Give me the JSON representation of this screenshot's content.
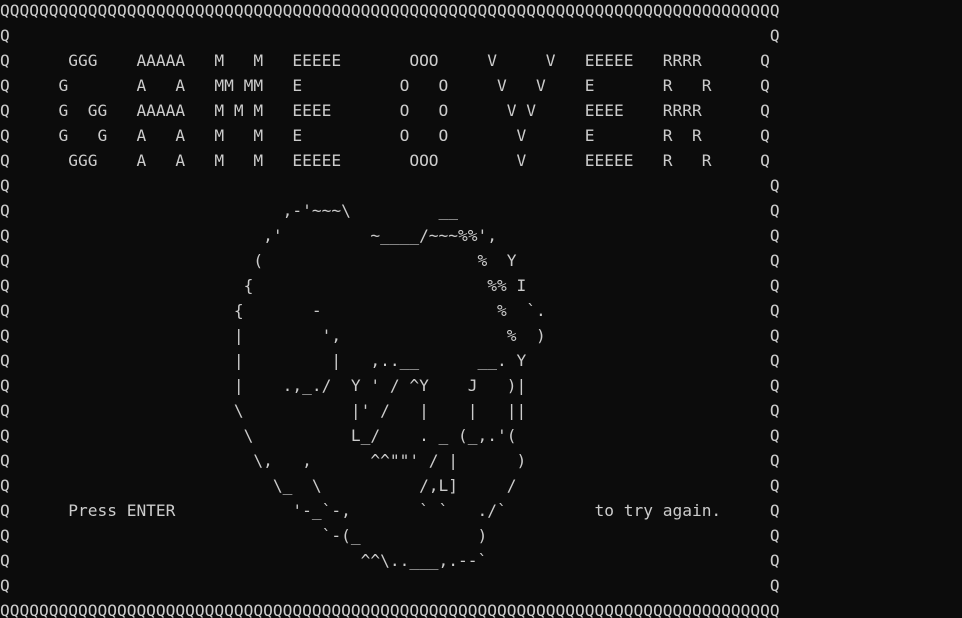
{
  "screen": {
    "border_char": "Q",
    "title": "GAME OVER",
    "prompt_left": "Press ENTER",
    "prompt_right": "to try again.",
    "lines": [
      "QQQQQQQQQQQQQQQQQQQQQQQQQQQQQQQQQQQQQQQQQQQQQQQQQQQQQQQQQQQQQQQQQQQQQQQQQQQQQQQQ",
      "Q                                                                              Q",
      "Q      GGG    AAAAA   M   M   EEEEE       OOO     V     V   EEEEE   RRRR      Q",
      "Q     G       A   A   MM MM   E          O   O     V   V    E       R   R     Q",
      "Q     G  GG   AAAAA   M M M   EEEE       O   O      V V     EEEE    RRRR      Q",
      "Q     G   G   A   A   M   M   E          O   O       V      E       R  R      Q",
      "Q      GGG    A   A   M   M   EEEEE       OOO        V      EEEEE   R   R     Q",
      "Q                                                                              Q",
      "Q                            ,-'~~~\\         __                                Q",
      "Q                          ,'         ~____/~~~%%',                            Q",
      "Q                         (                      %  Y                          Q",
      "Q                        {                        %% I                         Q",
      "Q                       {       -                  %  `.                       Q",
      "Q                       |        ',                 %  )                       Q",
      "Q                       |         |   ,..__      __. Y                         Q",
      "Q                       |    .,_./  Y ' / ^Y    J   )|                         Q",
      "Q                       \\           |' /   |    |   ||                         Q",
      "Q                        \\          L_/    . _ (_,.'(                          Q",
      "Q                         \\,   ,      ^^\"\"' / |      )                         Q",
      "Q                           \\_  \\          /,L]     /                          Q",
      "Q      Press ENTER            '-_`-,       ` `   ./`         to try again.     Q",
      "Q                                `-(_            )                             Q",
      "Q                                    ^^\\..___,.--`                             Q",
      "Q                                                                              Q",
      "QQQQQQQQQQQQQQQQQQQQQQQQQQQQQQQQQQQQQQQQQQQQQQQQQQQQQQQQQQQQQQQQQQQQQQQQQQQQQQQQ"
    ]
  }
}
